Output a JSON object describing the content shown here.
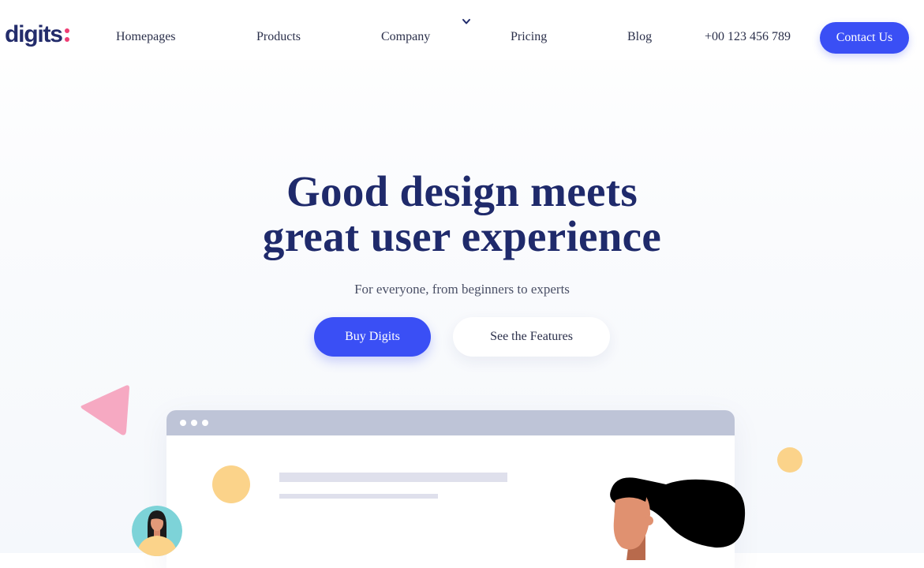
{
  "brand": {
    "logo_text": "digits",
    "accent": "#ef3d74"
  },
  "nav": {
    "items": [
      {
        "label": "Homepages"
      },
      {
        "label": "Products"
      },
      {
        "label": "Company"
      },
      {
        "label": "Pricing"
      },
      {
        "label": "Blog"
      }
    ],
    "dropdown_icon": "chevron-down-icon",
    "phone": "+00 123 456 789",
    "contact_label": "Contact Us"
  },
  "hero": {
    "title_line1": "Good design meets",
    "title_line2": "great user experience",
    "subtitle": "For everyone, from beginners to experts",
    "primary_cta": "Buy Digits",
    "secondary_cta": "See the Features"
  },
  "colors": {
    "primary": "#3a4ff5",
    "heading": "#1f2a6b",
    "pink": "#f6a9c2",
    "yellow": "#fbd38a",
    "browser_bar": "#bec4d7"
  }
}
